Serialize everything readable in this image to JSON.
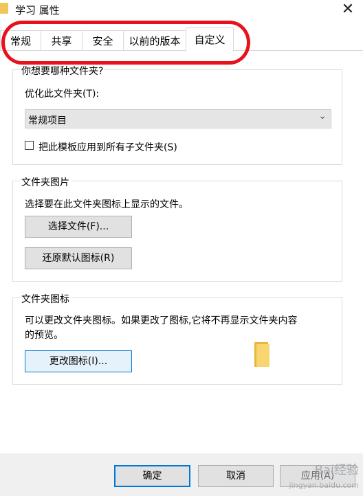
{
  "window": {
    "title": "学习 属性",
    "close_glyph": "✕"
  },
  "tabs": [
    {
      "label": "常规"
    },
    {
      "label": "共享"
    },
    {
      "label": "安全"
    },
    {
      "label": "以前的版本"
    },
    {
      "label": "自定义"
    }
  ],
  "active_tab": "自定义",
  "optimize": {
    "group_title": "你想要哪种文件夹?",
    "label": "优化此文件夹(T):",
    "select_value": "常规项目",
    "checkbox_label": "把此模板应用到所有子文件夹(S)",
    "checkbox_checked": false
  },
  "folder_pictures": {
    "group_title": "文件夹图片",
    "description": "选择要在此文件夹图标上显示的文件。",
    "choose_file_button": "选择文件(F)...",
    "restore_default_button": "还原默认图标(R)"
  },
  "folder_icons": {
    "group_title": "文件夹图标",
    "description_line1": "可以更改文件夹图标。如果更改了图标,它将不再显示文件夹内容",
    "description_line2": "的预览。",
    "change_icon_button": "更改图标(I)..."
  },
  "footer": {
    "ok_button": "确定",
    "cancel_button": "取消",
    "apply_button": "应用(A)"
  },
  "watermark": {
    "text": "Bai经验",
    "sub": "jingyan.baidu.com"
  },
  "colors": {
    "accent": "#0078d7",
    "annotation": "#e8121a",
    "folder": "#f8d56f"
  }
}
